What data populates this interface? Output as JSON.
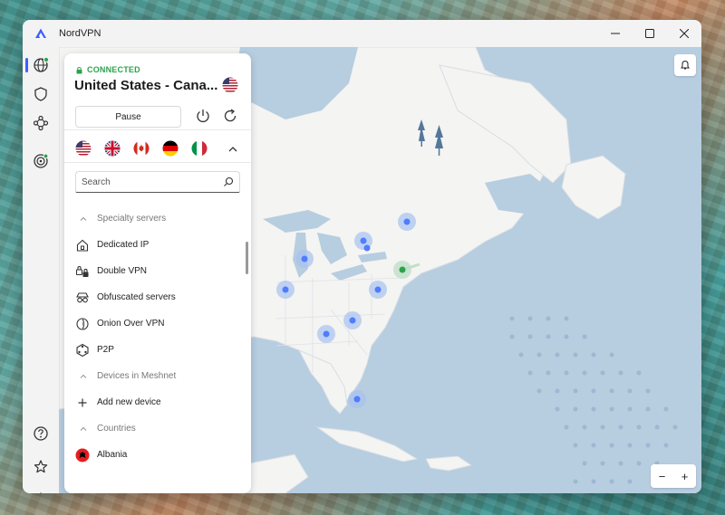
{
  "window": {
    "title": "NordVPN"
  },
  "status": {
    "label": "CONNECTED",
    "server": "United States - Cana..."
  },
  "controls": {
    "pause_label": "Pause"
  },
  "quick_flags": [
    "United States",
    "United Kingdom",
    "Canada",
    "Germany",
    "Italy"
  ],
  "search": {
    "placeholder": "Search"
  },
  "specialty": {
    "header": "Specialty servers",
    "items": [
      {
        "label": "Dedicated IP",
        "icon": "home-icon"
      },
      {
        "label": "Double VPN",
        "icon": "double-lock-icon"
      },
      {
        "label": "Obfuscated servers",
        "icon": "spy-glasses-icon"
      },
      {
        "label": "Onion Over VPN",
        "icon": "onion-icon"
      },
      {
        "label": "P2P",
        "icon": "p2p-icon"
      }
    ]
  },
  "meshnet": {
    "header": "Devices in Meshnet",
    "add_label": "Add new device"
  },
  "countries": {
    "header": "Countries",
    "items": [
      {
        "label": "Albania"
      }
    ]
  },
  "map": {
    "zoom_out": "−",
    "zoom_in": "+"
  },
  "colors": {
    "accent": "#3e5fff",
    "connected": "#2ca24c",
    "ocean": "#b7cde0",
    "land": "#f4f4f2"
  }
}
